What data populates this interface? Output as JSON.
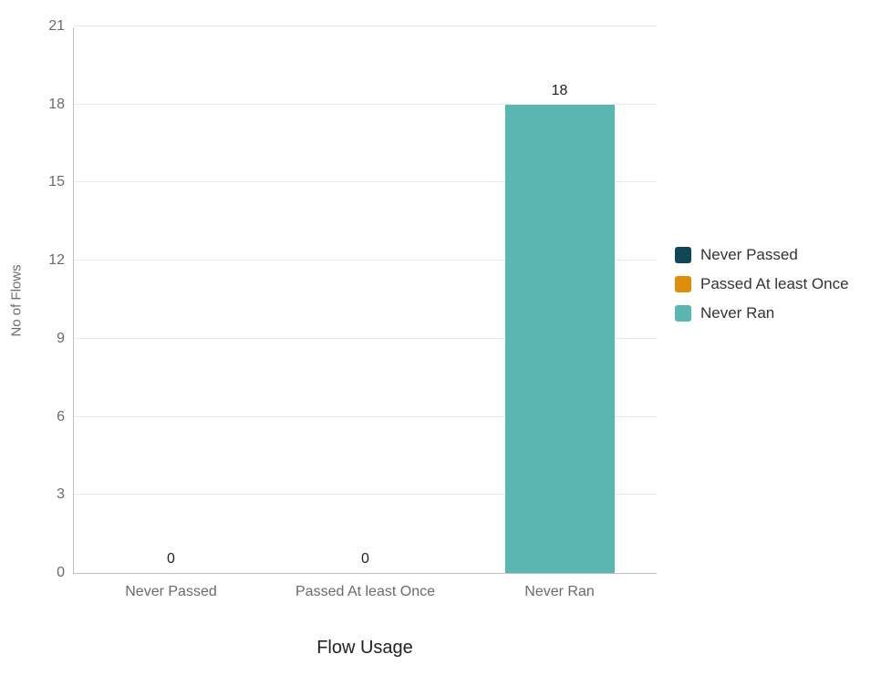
{
  "chart_data": {
    "type": "bar",
    "categories": [
      "Never Passed",
      "Passed At least Once",
      "Never Ran"
    ],
    "values": [
      0,
      0,
      18
    ],
    "colors": [
      "#0f4758",
      "#de8e0b",
      "#5ab6b0"
    ],
    "xlabel": "Flow Usage",
    "ylabel": "No of Flows",
    "ylim": [
      0,
      21
    ],
    "y_ticks": [
      0,
      3,
      6,
      9,
      12,
      15,
      18,
      21
    ],
    "legend": [
      {
        "name": "Never Passed",
        "color": "#0f4758"
      },
      {
        "name": "Passed At least Once",
        "color": "#de8e0b"
      },
      {
        "name": "Never Ran",
        "color": "#5ab6b0"
      }
    ]
  }
}
